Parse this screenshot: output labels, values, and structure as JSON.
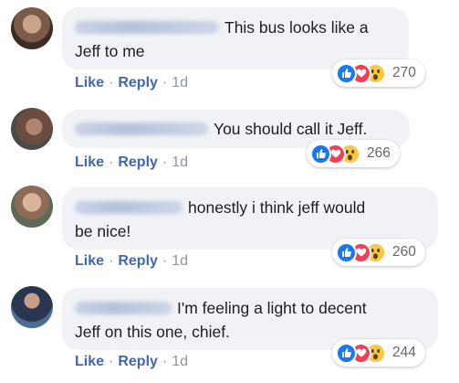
{
  "actions": {
    "like": "Like",
    "reply": "Reply",
    "separator": "·"
  },
  "colors": {
    "link": "#4267b2",
    "bubble": "#f0f2f5",
    "like": "#1877f2",
    "love": "#f33e58",
    "wow": "#f7c843"
  },
  "comments": [
    {
      "avatar_icon": "avatar-photo",
      "text_line1": "This bus looks like a",
      "text_line2": "Jeff to me",
      "time": "1d",
      "reactions": [
        "like-icon",
        "love-icon",
        "wow-icon"
      ],
      "reaction_count": "270"
    },
    {
      "avatar_icon": "avatar-photo",
      "text_line1": "You should call it Jeff.",
      "text_line2": "",
      "time": "1d",
      "reactions": [
        "like-icon",
        "love-icon",
        "wow-icon"
      ],
      "reaction_count": "266"
    },
    {
      "avatar_icon": "avatar-photo",
      "text_line1": "honestly i think jeff would",
      "text_line2": "be nice!",
      "time": "1d",
      "reactions": [
        "like-icon",
        "love-icon",
        "wow-icon"
      ],
      "reaction_count": "260"
    },
    {
      "avatar_icon": "avatar-photo",
      "text_line1": "I'm feeling a light to decent",
      "text_line2": "Jeff on this one, chief.",
      "time": "1d",
      "reactions": [
        "like-icon",
        "love-icon",
        "wow-icon"
      ],
      "reaction_count": "244"
    }
  ]
}
